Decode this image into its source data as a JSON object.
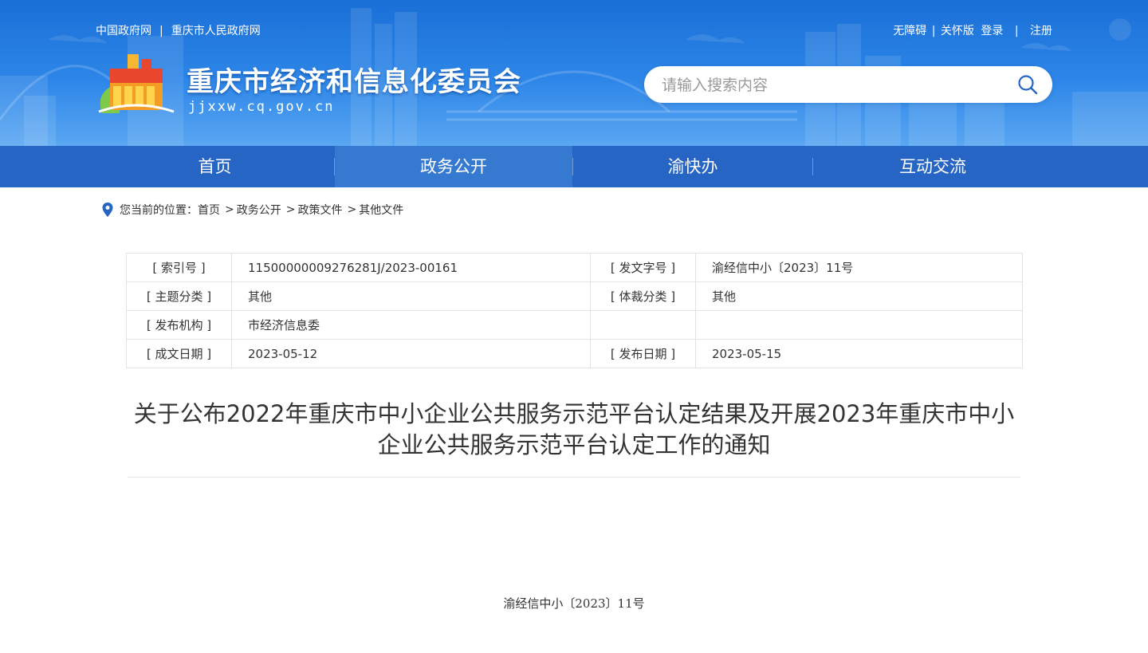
{
  "header": {
    "top_links_left": [
      "中国政府网",
      "重庆市人民政府网"
    ],
    "top_links_right": {
      "accessibility": "无障碍",
      "care_version": "关怀版",
      "login": "登录",
      "register": "注册"
    },
    "site_title": "重庆市经济和信息化委员会",
    "site_domain": "jjxxw.cq.gov.cn",
    "search": {
      "placeholder": "请输入搜索内容",
      "icon": "search-icon"
    },
    "colors": {
      "banner": "#2d86e8",
      "nav": "#2765c4",
      "nav_active": "#3679d1"
    }
  },
  "nav": {
    "items": [
      {
        "label": "首页",
        "active": false
      },
      {
        "label": "政务公开",
        "active": true
      },
      {
        "label": "渝快办",
        "active": false
      },
      {
        "label": "互动交流",
        "active": false
      }
    ]
  },
  "breadcrumb": {
    "prefix": "您当前的位置：",
    "items": [
      "首页",
      "政务公开",
      "政策文件",
      "其他文件"
    ],
    "icon": "location-pin-icon"
  },
  "meta": {
    "rows": [
      {
        "k1": "[ 索引号 ]",
        "v1": "11500000009276281J/2023-00161",
        "k2": "[ 发文字号 ]",
        "v2": "渝经信中小〔2023〕11号"
      },
      {
        "k1": "[ 主题分类 ]",
        "v1": "其他",
        "k2": "[ 体裁分类 ]",
        "v2": "其他"
      },
      {
        "k1": "[ 发布机构 ]",
        "v1": "市经济信息委",
        "k2": "",
        "v2": ""
      },
      {
        "k1": "[ 成文日期 ]",
        "v1": "2023-05-12",
        "k2": "[ 发布日期 ]",
        "v2": "2023-05-15"
      }
    ]
  },
  "article": {
    "title_line1": "关于公布2022年重庆市中小企业公共服务示范平台认定结果及开展2023年重庆市中小",
    "title_line2": "企业公共服务示范平台认定工作的通知",
    "doc_number": "渝经信中小〔2023〕11号"
  }
}
